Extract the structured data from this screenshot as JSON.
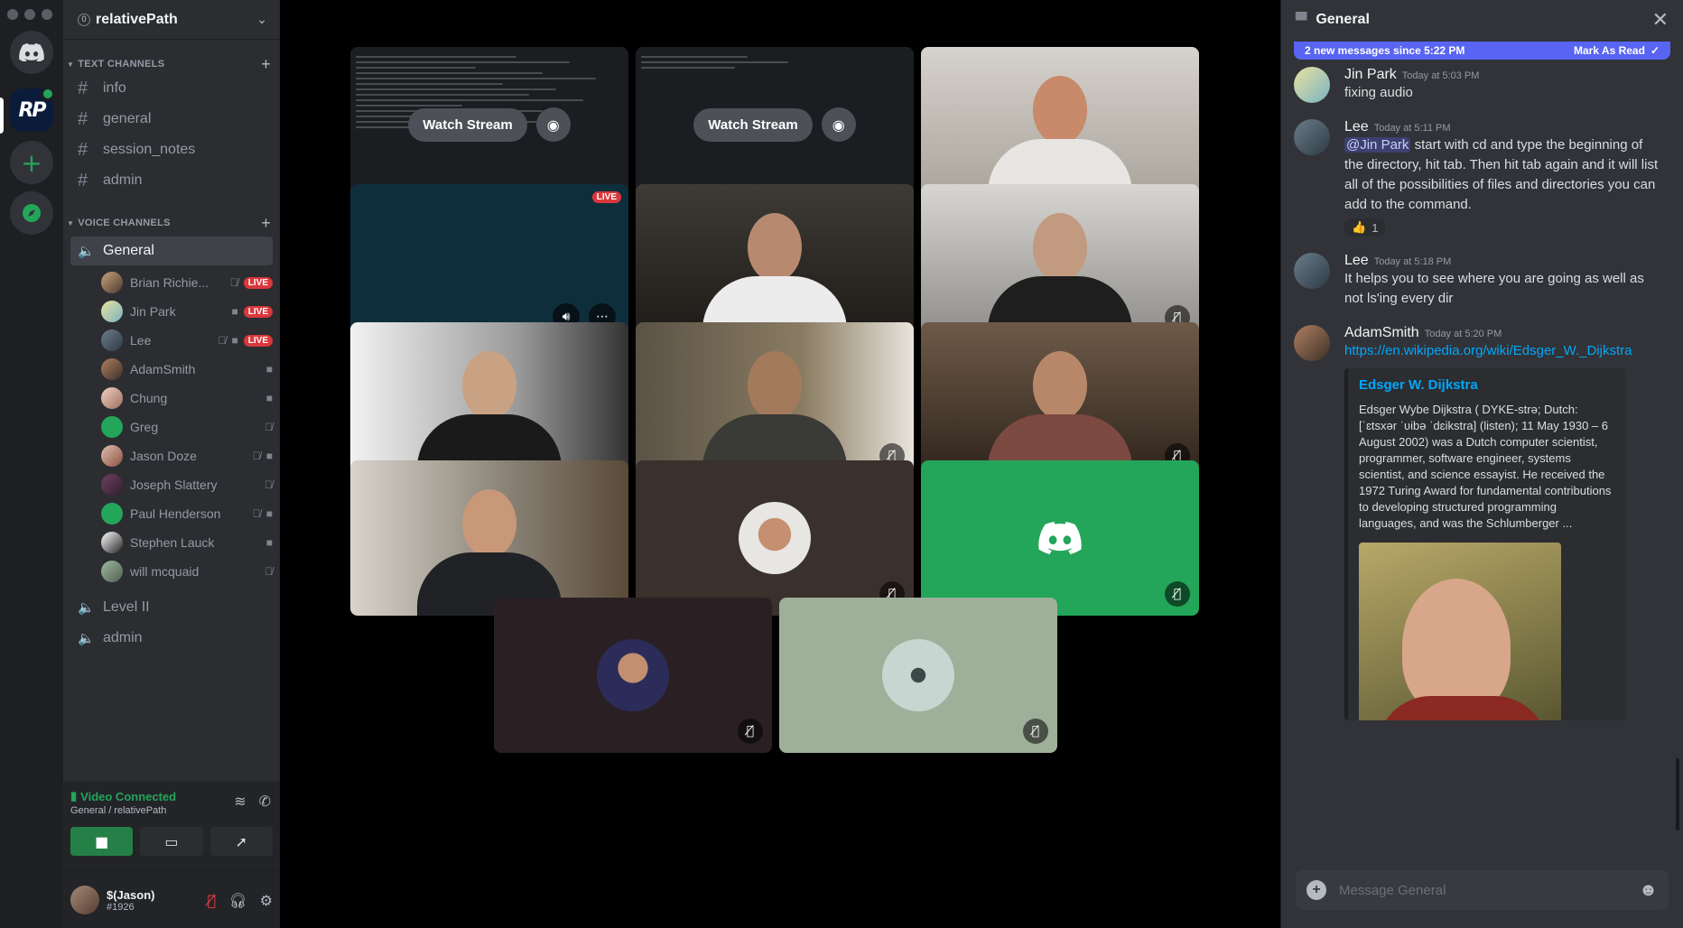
{
  "server": {
    "name": "relativePath",
    "icon_text": "RP",
    "badge_count_icon": "0"
  },
  "text_channels": {
    "label": "TEXT CHANNELS",
    "items": [
      {
        "name": "info"
      },
      {
        "name": "general"
      },
      {
        "name": "session_notes"
      },
      {
        "name": "admin"
      }
    ]
  },
  "voice_channels": {
    "label": "VOICE CHANNELS",
    "active": "General",
    "users": [
      {
        "name": "Brian Richie...",
        "live": "LIVE"
      },
      {
        "name": "Jin Park",
        "live": "LIVE"
      },
      {
        "name": "Lee",
        "live": "LIVE"
      },
      {
        "name": "AdamSmith"
      },
      {
        "name": "Chung"
      },
      {
        "name": "Greg"
      },
      {
        "name": "Jason Doze"
      },
      {
        "name": "Joseph Slattery"
      },
      {
        "name": "Paul Henderson"
      },
      {
        "name": "Stephen Lauck"
      },
      {
        "name": "will mcquaid"
      }
    ],
    "others": [
      "Level II",
      "admin"
    ]
  },
  "voice_panel": {
    "status": "Video Connected",
    "location": "General / relativePath"
  },
  "user": {
    "name": "$(Jason)",
    "tag": "#1926"
  },
  "stage": {
    "watch_label": "Watch Stream",
    "live_label": "LIVE"
  },
  "chat": {
    "title": "General",
    "new_messages": "2 new messages since 5:22 PM",
    "mark_read": "Mark As Read",
    "messages": [
      {
        "author": "Jin Park",
        "time": "Today at 5:03 PM",
        "text": "fixing audio"
      },
      {
        "author": "Lee",
        "time": "Today at 5:11 PM",
        "mention": "@Jin Park",
        "text": " start with cd and type the beginning of the directory, hit tab.  Then hit tab again and it will list all of the possibilities of files and directories you can add to the command.",
        "reaction_emoji": "👍",
        "reaction_count": "1"
      },
      {
        "author": "Lee",
        "time": "Today at 5:18 PM",
        "text": "It helps you to see where you are going as well as not ls'ing every dir"
      },
      {
        "author": "AdamSmith",
        "time": "Today at 5:20 PM",
        "link": "https://en.wikipedia.org/wiki/Edsger_W._Dijkstra",
        "embed_title": "Edsger W. Dijkstra",
        "embed_desc": "Edsger Wybe Dijkstra ( DYKE-strə; Dutch: [ˈɛtsxər ˈʋibə ˈdɛikstra] (listen); 11 May 1930 – 6 August 2002) was a Dutch computer scientist, programmer, software engineer, systems scientist, and science essayist. He received the 1972 Turing Award for fundamental contributions to developing structured programming languages, and was the Schlumberger ..."
      }
    ],
    "input_placeholder": "Message General"
  },
  "colors": {
    "accent": "#5865f2",
    "online": "#23a55a",
    "live": "#da373c",
    "link": "#00a8fc"
  }
}
